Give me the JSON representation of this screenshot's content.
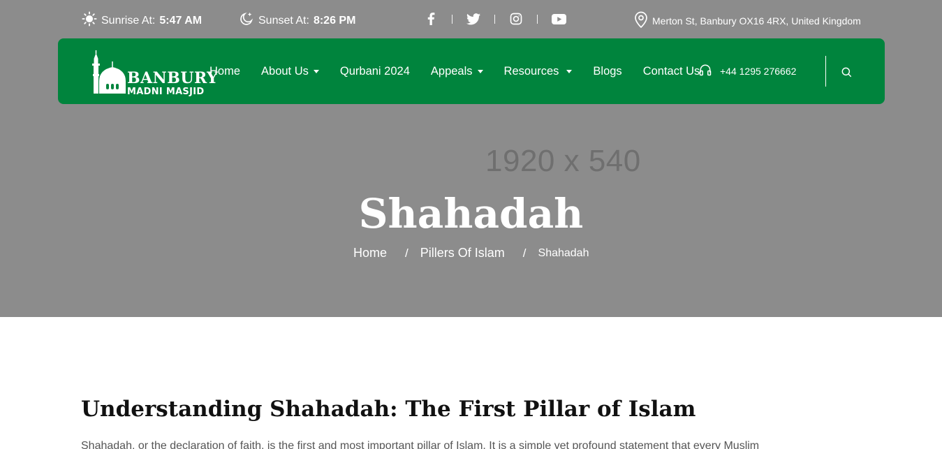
{
  "topbar": {
    "sunrise": {
      "icon": "sun-icon",
      "label": "Sunrise At:",
      "time": "5:47 AM"
    },
    "sunset": {
      "icon": "moon-icon",
      "label": "Sunset At:",
      "time": "8:26 PM"
    },
    "social": [
      "facebook-icon",
      "twitter-icon",
      "instagram-icon",
      "youtube-icon"
    ],
    "address": {
      "icon": "location-pin-icon",
      "text": "Merton St, Banbury OX16 4RX, United Kingdom"
    }
  },
  "navbar": {
    "logo": {
      "line1": "BANBURY",
      "line2": "MADNI MASJID"
    },
    "items": [
      {
        "label": "Home",
        "dropdown": false
      },
      {
        "label": "About Us",
        "dropdown": true
      },
      {
        "label": "Qurbani 2024",
        "dropdown": false
      },
      {
        "label": "Appeals",
        "dropdown": true
      },
      {
        "label": "Resources",
        "dropdown": true
      },
      {
        "label": "Blogs",
        "dropdown": false
      },
      {
        "label": "Contact Us",
        "dropdown": false
      }
    ],
    "phone": {
      "icon": "headphones-icon",
      "number": "+44 1295 276662"
    },
    "search_icon": "search-icon"
  },
  "hero": {
    "placeholder": "1920 x 540",
    "title": "Shahadah",
    "breadcrumb": {
      "home": "Home",
      "parent": "Pillers Of Islam",
      "current": "Shahadah",
      "separator": "/"
    }
  },
  "content": {
    "title": "Understanding Shahadah: The First Pillar of Islam",
    "paragraph": "Shahadah, or the declaration of faith, is the first and most important pillar of Islam. It is a simple yet profound statement that every Muslim"
  },
  "colors": {
    "brand_green": "#00843d",
    "hero_bg": "#8c8c8c",
    "white": "#ffffff"
  }
}
